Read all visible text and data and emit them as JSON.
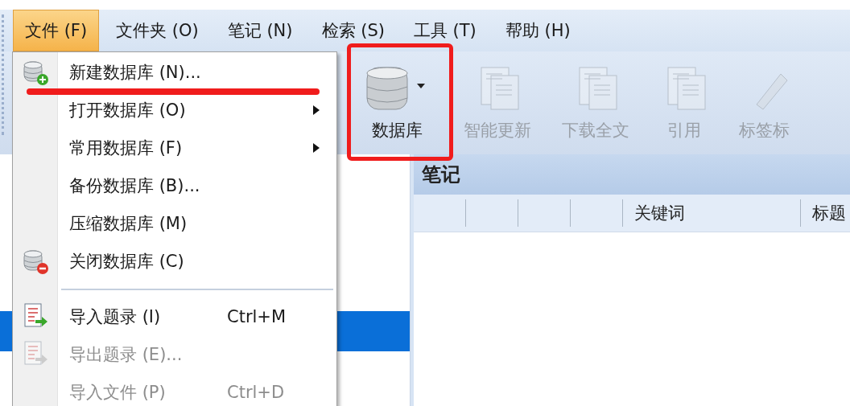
{
  "menubar": [
    {
      "label": "文件 (F)",
      "selected": true
    },
    {
      "label": "文件夹 (O)",
      "selected": false
    },
    {
      "label": "笔记 (N)",
      "selected": false
    },
    {
      "label": "检索 (S)",
      "selected": false
    },
    {
      "label": "工具 (T)",
      "selected": false
    },
    {
      "label": "帮助 (H)",
      "selected": false
    }
  ],
  "file_menu": {
    "items": [
      {
        "kind": "item",
        "label": "新建数据库 (N)...",
        "submenu": false,
        "disabled": false
      },
      {
        "kind": "item",
        "label": "打开数据库 (O)",
        "submenu": true,
        "disabled": false
      },
      {
        "kind": "item",
        "label": "常用数据库 (F)",
        "submenu": true,
        "disabled": false
      },
      {
        "kind": "item",
        "label": "备份数据库 (B)...",
        "submenu": false,
        "disabled": false
      },
      {
        "kind": "item",
        "label": "压缩数据库 (M)",
        "submenu": false,
        "disabled": false
      },
      {
        "kind": "item",
        "label": "关闭数据库 (C)",
        "submenu": false,
        "disabled": false
      },
      {
        "kind": "separator"
      },
      {
        "kind": "item",
        "label": "导入题录 (I)",
        "shortcut": "Ctrl+M",
        "submenu": false,
        "disabled": false
      },
      {
        "kind": "item",
        "label": "导出题录 (E)...",
        "submenu": false,
        "disabled": true
      },
      {
        "kind": "item",
        "label": "导入文件 (P)",
        "shortcut": "Ctrl+D",
        "submenu": false,
        "disabled": true
      }
    ]
  },
  "toolbar": [
    {
      "label": "数据库",
      "disabled": false
    },
    {
      "label": "智能更新",
      "disabled": true
    },
    {
      "label": "下载全文",
      "disabled": true
    },
    {
      "label": "引用",
      "disabled": true
    },
    {
      "label": "标签标",
      "disabled": true
    }
  ],
  "notes_panel": {
    "title": "笔记",
    "columns": [
      "关键词",
      "标题"
    ]
  }
}
